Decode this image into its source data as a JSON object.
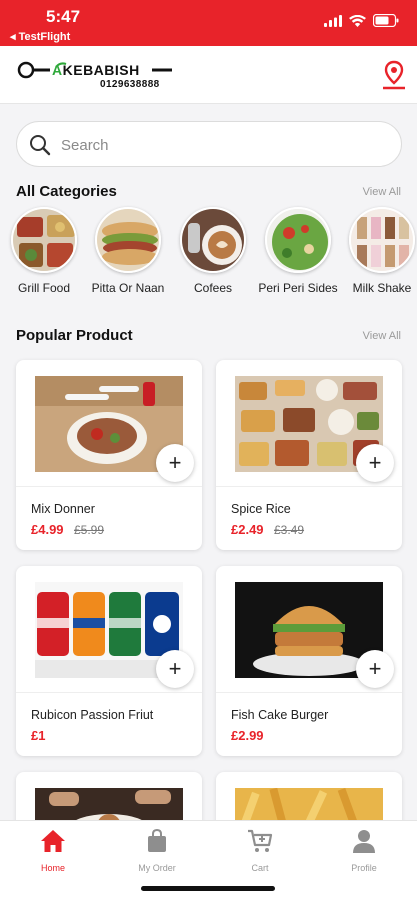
{
  "status_bar": {
    "time": "5:47",
    "back_label": "◂ TestFlight"
  },
  "header": {
    "logo_brand_prefix": "A",
    "logo_brand": "KEBABISH",
    "logo_phone": "0129638888"
  },
  "search": {
    "placeholder": "Search"
  },
  "categories_section": {
    "title": "All Categories",
    "view_all": "View All",
    "items": [
      {
        "label": "Grill Food"
      },
      {
        "label": "Pitta Or Naan"
      },
      {
        "label": "Cofees"
      },
      {
        "label": "Peri Peri Sides"
      },
      {
        "label": "Milk Shake"
      }
    ]
  },
  "products_section": {
    "title": "Popular Product",
    "view_all": "View All",
    "items": [
      {
        "name": "Mix Donner",
        "price": "£4.99",
        "old_price": "£5.99"
      },
      {
        "name": "Spice Rice",
        "price": "£2.49",
        "old_price": "£3.49"
      },
      {
        "name": "Rubicon Passion Friut",
        "price": "£1",
        "old_price": ""
      },
      {
        "name": "Fish Cake Burger",
        "price": "£2.99",
        "old_price": ""
      }
    ]
  },
  "tabbar": {
    "items": [
      {
        "label": "Home",
        "icon": "home-icon",
        "active": true
      },
      {
        "label": "My Order",
        "icon": "bag-icon",
        "active": false
      },
      {
        "label": "Cart",
        "icon": "cart-icon",
        "active": false
      },
      {
        "label": "Profile",
        "icon": "user-icon",
        "active": false
      }
    ]
  },
  "colors": {
    "accent": "#e8232a",
    "brand_green": "#2ea83a",
    "background": "#f4f4f6"
  }
}
